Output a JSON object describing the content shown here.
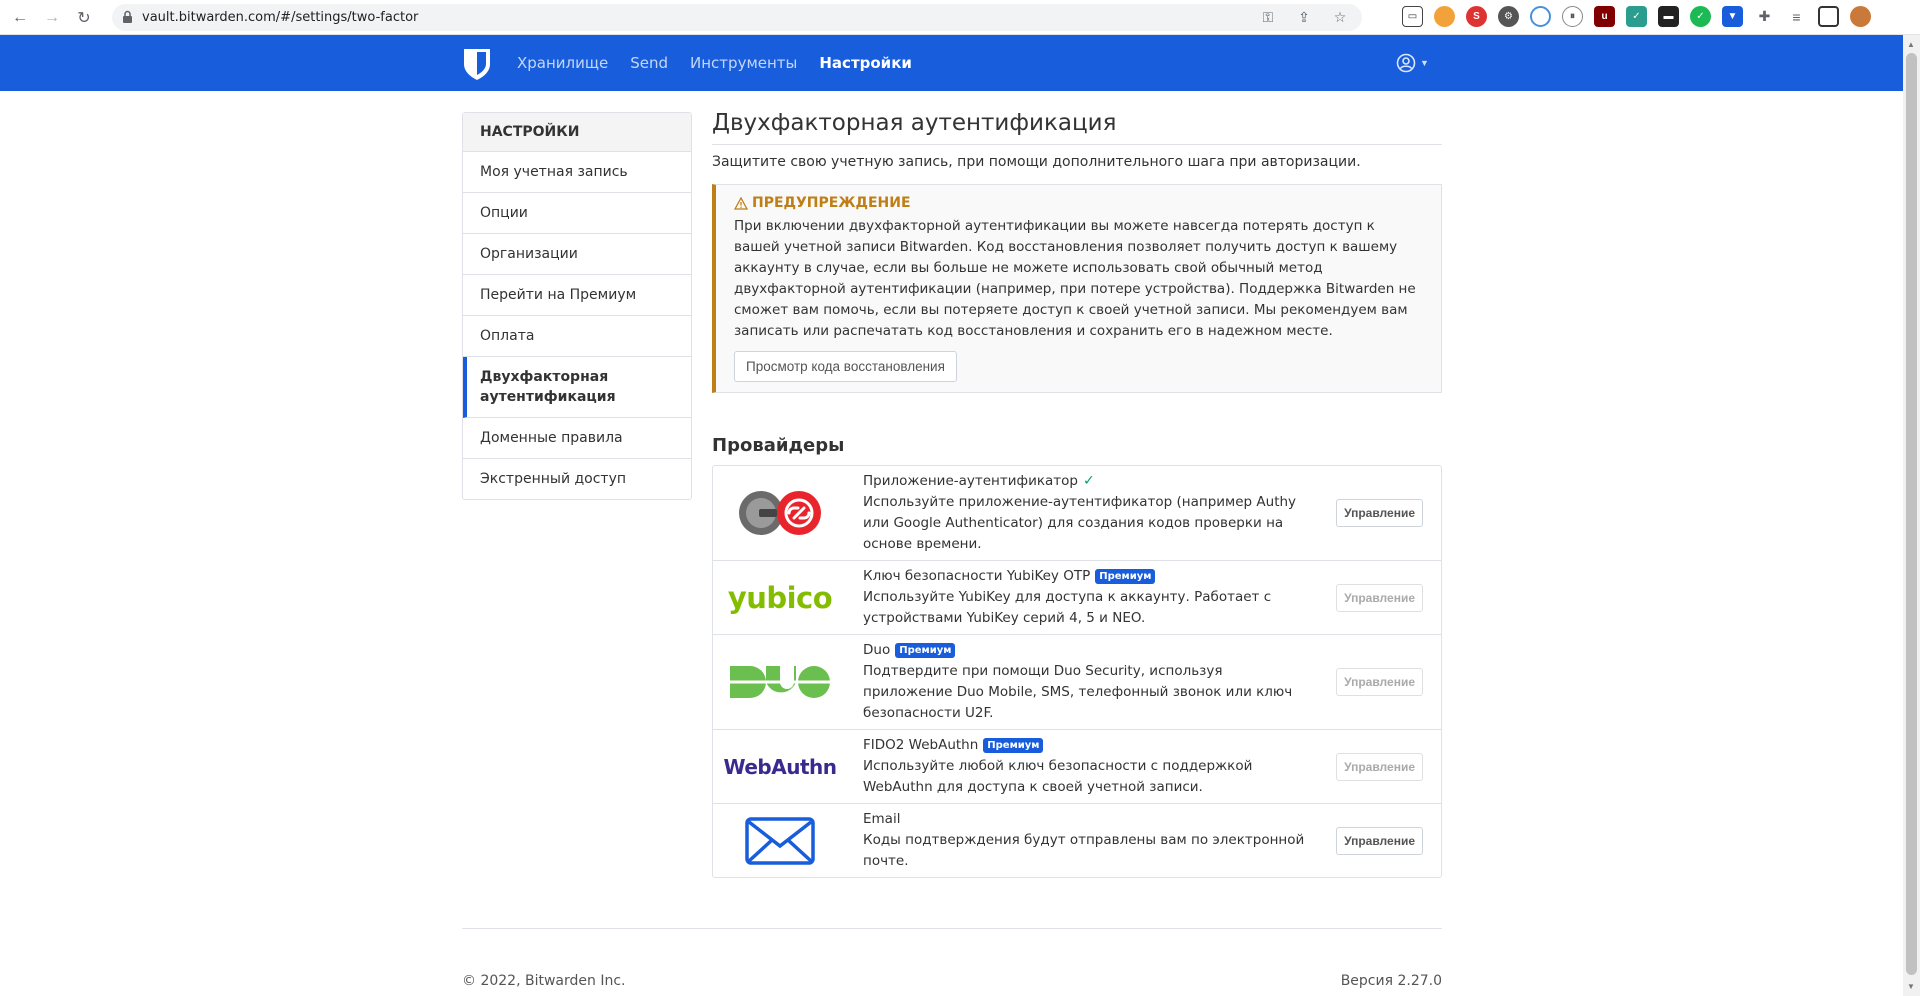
{
  "browser": {
    "url": "vault.bitwarden.com/#/settings/two-factor"
  },
  "nav": {
    "items": [
      {
        "label": "Хранилище"
      },
      {
        "label": "Send"
      },
      {
        "label": "Инструменты"
      },
      {
        "label": "Настройки"
      }
    ]
  },
  "sidebar": {
    "title": "НАСТРОЙКИ",
    "items": [
      {
        "label": "Моя учетная запись"
      },
      {
        "label": "Опции"
      },
      {
        "label": "Организации"
      },
      {
        "label": "Перейти на Премиум"
      },
      {
        "label": "Оплата"
      },
      {
        "label": "Двухфакторная аутентификация"
      },
      {
        "label": "Доменные правила"
      },
      {
        "label": "Экстренный доступ"
      }
    ]
  },
  "main": {
    "title": "Двухфакторная аутентификация",
    "subtitle": "Защитите свою учетную запись, при помощи дополнительного шага при авторизации.",
    "warning": {
      "title": "ПРЕДУПРЕЖДЕНИЕ",
      "body": "При включении двухфакторной аутентификации вы можете навсегда потерять доступ к вашей учетной записи Bitwarden. Код восстановления позволяет получить доступ к вашему аккаунту в случае, если вы больше не можете использовать свой обычный метод двухфакторной аутентификации (например, при потере устройства). Поддержка Bitwarden не сможет вам помочь, если вы потеряете доступ к своей учетной записи. Мы рекомендуем вам записать или распечатать код восстановления и сохранить его в надежном месте.",
      "button": "Просмотр кода восстановления"
    },
    "providers_title": "Провайдеры",
    "providers": [
      {
        "name": "Приложение-аутентификатор",
        "desc": "Используйте приложение-аутентификатор (например Authy или Google Authenticator) для создания кодов проверки на основе времени.",
        "badge": "",
        "manage": "Управление"
      },
      {
        "name": "Ключ безопасности YubiKey OTP",
        "desc": "Используйте YubiKey для доступа к аккаунту. Работает с устройствами YubiKey серий 4, 5 и NEO.",
        "badge": "Премиум",
        "manage": "Управление"
      },
      {
        "name": "Duo",
        "desc": "Подтвердите при помощи Duo Security, используя приложение Duo Mobile, SMS, телефонный звонок или ключ безопасности U2F.",
        "badge": "Премиум",
        "manage": "Управление"
      },
      {
        "name": "FIDO2 WebAuthn",
        "desc": "Используйте любой ключ безопасности с поддержкой WebAuthn для доступа к своей учетной записи.",
        "badge": "Премиум",
        "manage": "Управление"
      },
      {
        "name": "Email",
        "desc": "Коды подтверждения будут отправлены вам по электронной почте.",
        "badge": "",
        "manage": "Управление"
      }
    ],
    "logos": {
      "yubico": "yubico",
      "webauthn": "WebAuthn"
    }
  },
  "footer": {
    "copyright": "© 2022, Bitwarden Inc.",
    "version": "Версия 2.27.0"
  },
  "colors": {
    "brand": "#175ddc",
    "warning": "#bf7e16"
  }
}
